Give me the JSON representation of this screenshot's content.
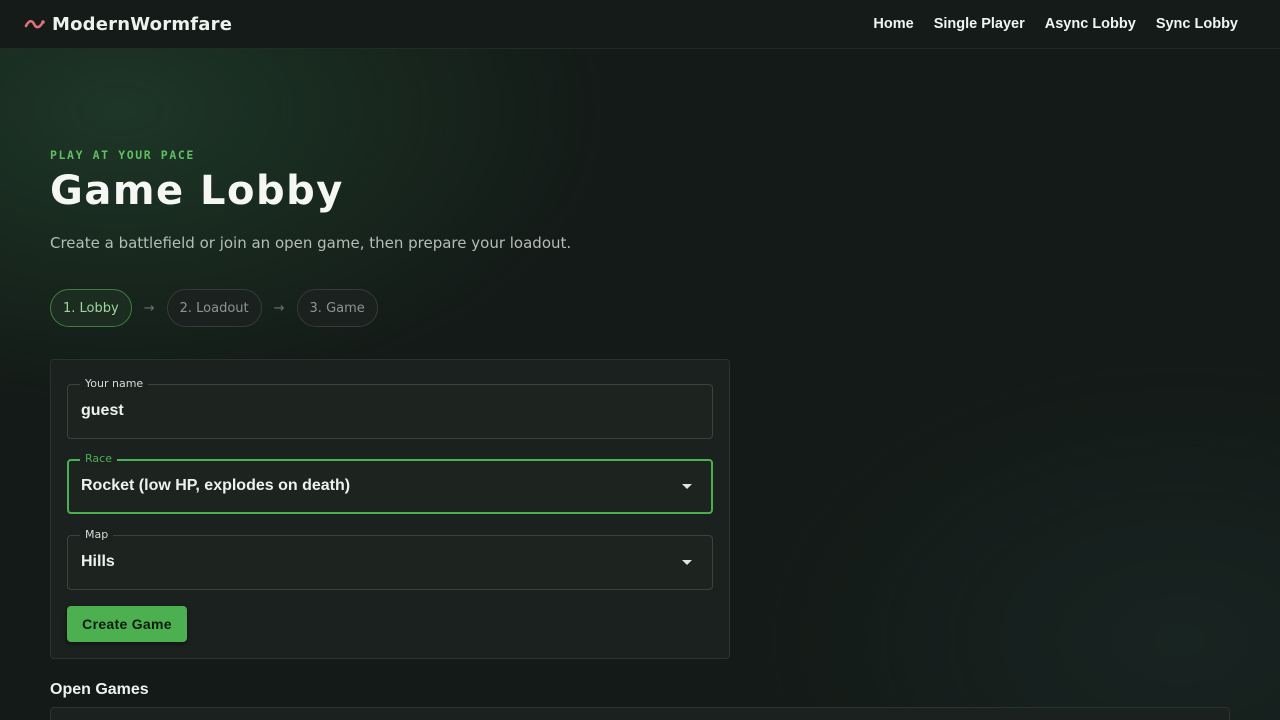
{
  "app": {
    "name": "ModernWormfare",
    "logo_icon": "worm-icon",
    "accent_color": "#4caf50",
    "logo_color": "#e0707a"
  },
  "nav": {
    "items": [
      {
        "label": "Home"
      },
      {
        "label": "Single Player"
      },
      {
        "label": "Async Lobby"
      },
      {
        "label": "Sync Lobby"
      }
    ]
  },
  "hero": {
    "eyebrow": "PLAY AT YOUR PACE",
    "title": "Game Lobby",
    "subtitle": "Create a battlefield or join an open game, then prepare your loadout."
  },
  "steps": {
    "items": [
      {
        "label": "1. Lobby",
        "active": true
      },
      {
        "label": "2. Loadout",
        "active": false
      },
      {
        "label": "3. Game",
        "active": false
      }
    ],
    "separator": "→"
  },
  "form": {
    "name": {
      "label": "Your name",
      "value": "guest"
    },
    "race": {
      "label": "Race",
      "value": "Rocket (low HP, explodes on death)",
      "focused": true
    },
    "map": {
      "label": "Map",
      "value": "Hills"
    },
    "submit_label": "Create Game"
  },
  "open_games": {
    "title": "Open Games"
  }
}
